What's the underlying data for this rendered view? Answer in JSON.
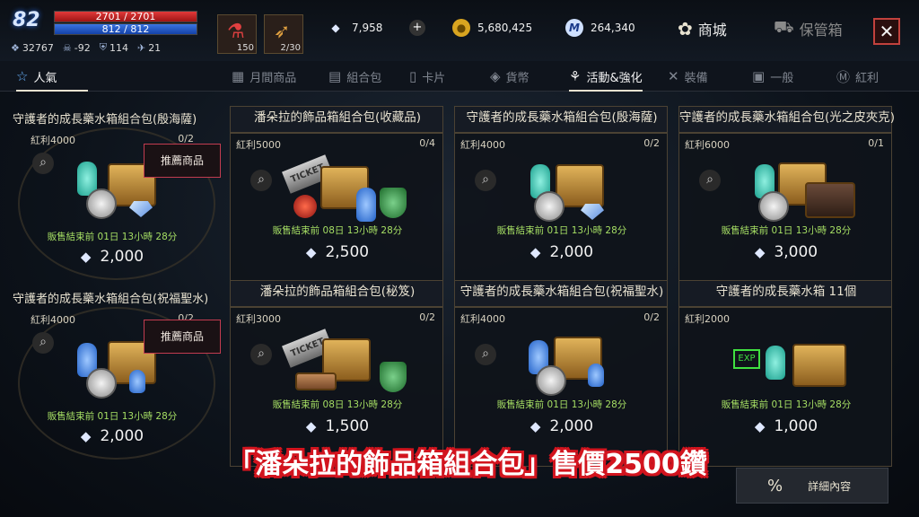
{
  "player": {
    "level": "82",
    "hp": "2701 / 2701",
    "mp": "812 / 812",
    "stats": [
      {
        "icon": "wing-icon",
        "value": "32767"
      },
      {
        "icon": "skull-icon",
        "value": "-92"
      },
      {
        "icon": "shield-icon",
        "value": "114"
      },
      {
        "icon": "eagle-icon",
        "value": "21"
      }
    ]
  },
  "slots": [
    {
      "icon": "potion-icon",
      "count": "150"
    },
    {
      "icon": "feather-icon",
      "count": "2/30"
    }
  ],
  "currencies": [
    {
      "icon": "diamond-icon",
      "value": "7,958"
    },
    {
      "icon": "gold-coin-icon",
      "value": "5,680,425"
    },
    {
      "icon": "m-coin-icon",
      "value": "264,340"
    }
  ],
  "header": {
    "shop_label": "商城",
    "safe_label": "保管箱",
    "close_label": "✕"
  },
  "tabs": [
    {
      "label": "人氣",
      "active": true
    },
    {
      "label": "月間商品",
      "active": false
    },
    {
      "label": "組合包",
      "active": false
    },
    {
      "label": "卡片",
      "active": false
    },
    {
      "label": "貨幣",
      "active": false
    },
    {
      "label": "活動&強化",
      "active": true
    },
    {
      "label": "裝備",
      "active": false
    },
    {
      "label": "一般",
      "active": false
    },
    {
      "label": "紅利",
      "active": false
    }
  ],
  "left_items": [
    {
      "title": "守護者的成長藥水箱組合包(殷海薩)",
      "bonus": "紅利4000",
      "qty": "0/2",
      "rec": "推薦商品",
      "timer": "販售結束前 01日 13小時 28分",
      "price": "2,000"
    },
    {
      "title": "守護者的成長藥水箱組合包(祝福聖水)",
      "bonus": "紅利4000",
      "qty": "0/2",
      "rec": "推薦商品",
      "timer": "販售結束前 01日 13小時 28分",
      "price": "2,000"
    }
  ],
  "cards": [
    {
      "title": "潘朵拉的飾品箱組合包(收藏品)",
      "bonus": "紅利5000",
      "qty": "0/4",
      "timer": "販售結束前 08日 13小時 28分",
      "price": "2,500"
    },
    {
      "title": "守護者的成長藥水箱組合包(殷海薩)",
      "bonus": "紅利4000",
      "qty": "0/2",
      "timer": "販售結束前 01日 13小時 28分",
      "price": "2,000"
    },
    {
      "title": "守護者的成長藥水箱組合包(光之皮夾克)",
      "bonus": "紅利6000",
      "qty": "0/1",
      "timer": "販售結束前 01日 13小時 28分",
      "price": "3,000"
    },
    {
      "title": "潘朵拉的飾品箱組合包(秘笈)",
      "bonus": "紅利3000",
      "qty": "0/2",
      "timer": "販售結束前 08日 13小時 28分",
      "price": "1,500"
    },
    {
      "title": "守護者的成長藥水箱組合包(祝福聖水)",
      "bonus": "紅利4000",
      "qty": "0/2",
      "timer": "販售結束前 01日 13小時 28分",
      "price": "2,000"
    },
    {
      "title": "守護者的成長藥水箱 11個",
      "bonus": "紅利2000",
      "qty": "",
      "timer": "販售結束前 01日 13小時 28分",
      "price": "1,000"
    }
  ],
  "art_labels": {
    "ticket": "TICKET",
    "exp": "EXP"
  },
  "subtitle": "「潘朵拉的飾品箱組合包」售價2500鑽",
  "detail": {
    "icon_text": "%",
    "label": "詳細內容"
  },
  "colors": {
    "accent_red": "#c2413d",
    "timer_green": "#a6df64",
    "hp_red": "#e23a3a",
    "mp_blue": "#3a74e2"
  }
}
